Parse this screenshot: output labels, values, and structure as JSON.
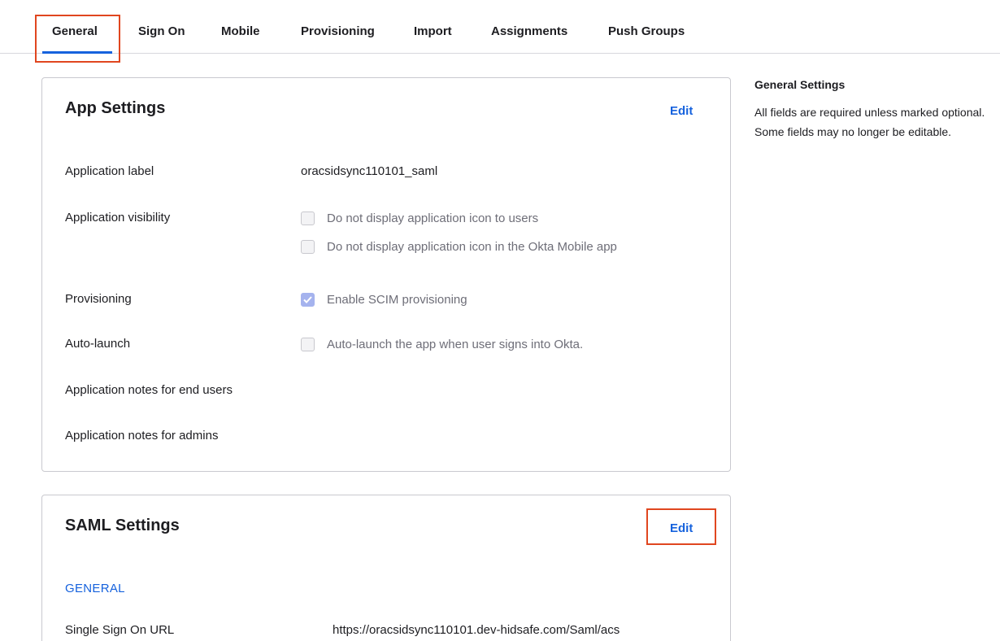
{
  "tabs": [
    {
      "label": "General"
    },
    {
      "label": "Sign On"
    },
    {
      "label": "Mobile"
    },
    {
      "label": "Provisioning"
    },
    {
      "label": "Import"
    },
    {
      "label": "Assignments"
    },
    {
      "label": "Push Groups"
    }
  ],
  "active_tab": "General",
  "app_settings": {
    "title": "App Settings",
    "edit_label": "Edit",
    "rows": {
      "application_label": {
        "label": "Application label",
        "value": "oracsidsync110101_saml"
      },
      "application_visibility": {
        "label": "Application visibility",
        "options": [
          {
            "text": "Do not display application icon to users",
            "checked": false
          },
          {
            "text": "Do not display application icon in the Okta Mobile app",
            "checked": false
          }
        ]
      },
      "provisioning": {
        "label": "Provisioning",
        "option": {
          "text": "Enable SCIM provisioning",
          "checked": true
        }
      },
      "auto_launch": {
        "label": "Auto-launch",
        "option": {
          "text": "Auto-launch the app when user signs into Okta.",
          "checked": false
        }
      },
      "notes_end_users": {
        "label": "Application notes for end users"
      },
      "notes_admins": {
        "label": "Application notes for admins"
      }
    }
  },
  "saml_settings": {
    "title": "SAML Settings",
    "edit_label": "Edit",
    "section": "GENERAL",
    "sso_url": {
      "label": "Single Sign On URL",
      "value": "https://oracsidsync110101.dev-hidsafe.com/Saml/acs"
    }
  },
  "sidebar": {
    "title": "General Settings",
    "text": "All fields are required unless marked optional. Some fields may no longer be editable."
  },
  "colors": {
    "accent": "#1662dd",
    "highlight": "#e0461f",
    "checked": "#a5b3ee"
  }
}
